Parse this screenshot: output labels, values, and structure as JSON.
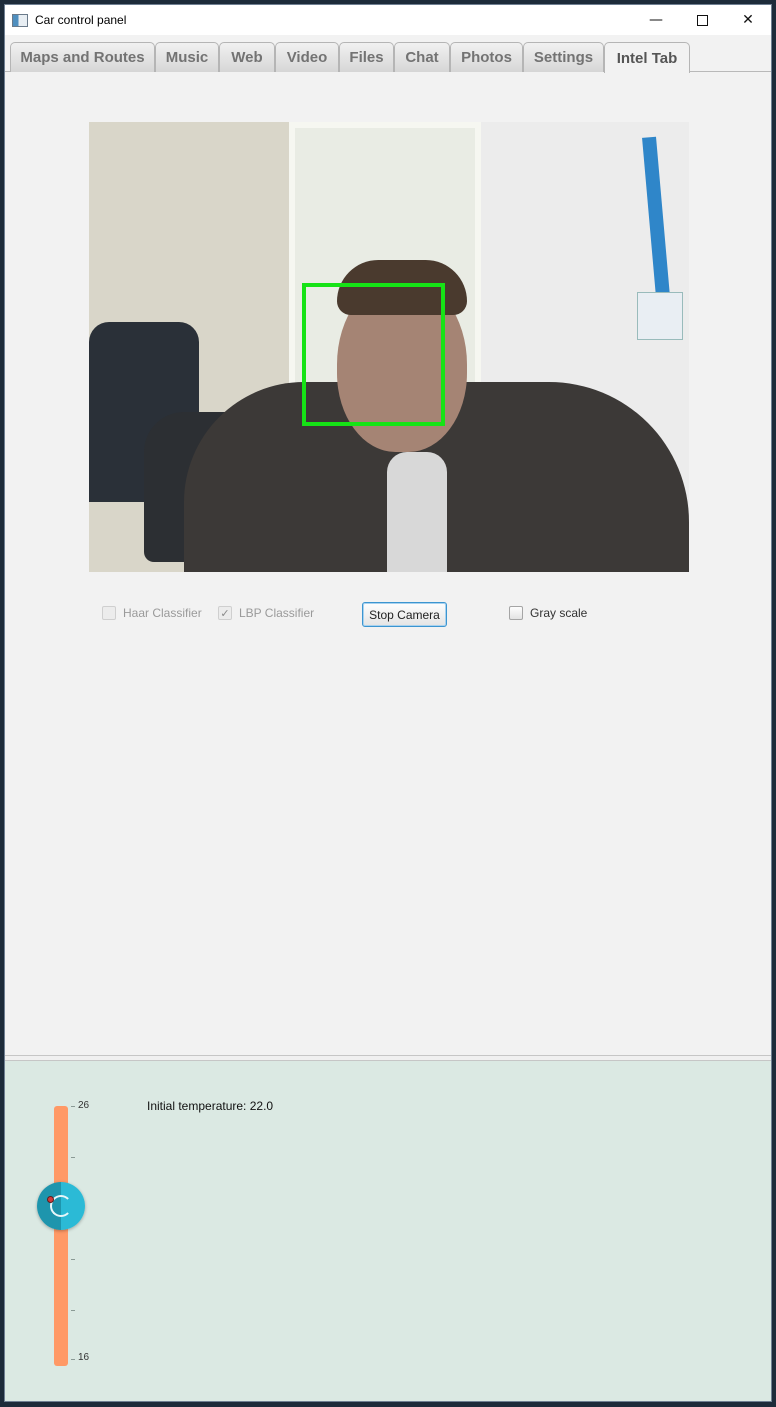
{
  "window": {
    "title": "Car control panel",
    "controls": {
      "minimize": "—",
      "maximize": "",
      "close": "✕"
    }
  },
  "tabs": [
    {
      "label": "Maps and Routes",
      "active": false
    },
    {
      "label": "Music",
      "active": false
    },
    {
      "label": "Web",
      "active": false
    },
    {
      "label": "Video",
      "active": false
    },
    {
      "label": "Files",
      "active": false
    },
    {
      "label": "Chat",
      "active": false
    },
    {
      "label": "Photos",
      "active": false
    },
    {
      "label": "Settings",
      "active": false
    },
    {
      "label": "Intel Tab",
      "active": true
    }
  ],
  "camera": {
    "face_box_color": "#16e316"
  },
  "controls": {
    "haar": {
      "label": "Haar Classifier",
      "checked": false,
      "disabled": true
    },
    "lbp": {
      "label": "LBP Classifier",
      "checked": true,
      "disabled": true,
      "checkmark": "✓"
    },
    "stop_camera": "Stop Camera",
    "gray": {
      "label": "Gray scale",
      "checked": false,
      "disabled": false
    }
  },
  "temperature": {
    "max_label": "26",
    "min_label": "16",
    "min": 16,
    "max": 26,
    "value": 22.0,
    "info_text": "Initial temperature: 22.0",
    "track_color": "#ff9966",
    "knob_color": "#2bbad6"
  }
}
